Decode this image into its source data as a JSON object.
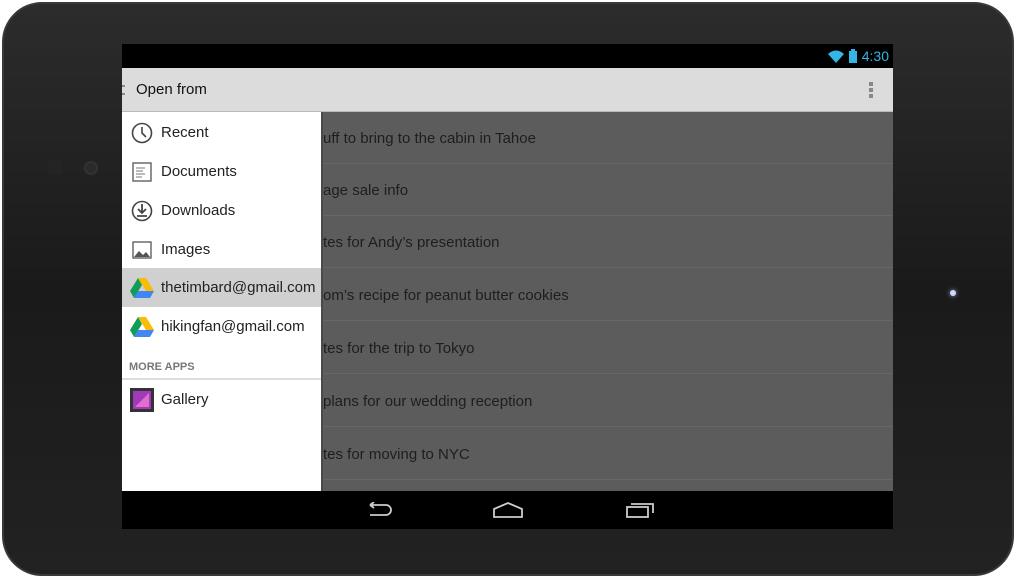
{
  "status": {
    "time": "4:30",
    "icons": [
      "wifi-icon",
      "battery-icon"
    ],
    "accent": "#33b5e5"
  },
  "actionbar": {
    "title": "Open from"
  },
  "drawer": {
    "items": [
      {
        "label": "Recent",
        "icon": "clock-icon"
      },
      {
        "label": "Documents",
        "icon": "document-icon"
      },
      {
        "label": "Downloads",
        "icon": "download-icon"
      },
      {
        "label": "Images",
        "icon": "image-icon"
      },
      {
        "label": "thetimbard@gmail.com",
        "icon": "google-drive-icon",
        "selected": true
      },
      {
        "label": "hikingfan@gmail.com",
        "icon": "google-drive-icon"
      }
    ],
    "section": "MORE APPS",
    "apps": [
      {
        "label": "Gallery",
        "icon": "gallery-icon"
      }
    ]
  },
  "files": [
    "uff to bring to the cabin in Tahoe",
    "age sale info",
    "tes for Andy’s presentation",
    "om’s recipe for peanut butter cookies",
    "tes for the trip to Tokyo",
    "plans for our wedding reception",
    "tes for moving to NYC"
  ],
  "nav": [
    "back-icon",
    "home-icon",
    "recents-icon"
  ]
}
